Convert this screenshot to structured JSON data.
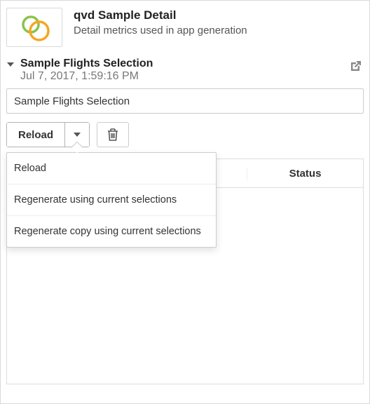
{
  "app": {
    "title": "qvd Sample Detail",
    "subtitle": "Detail metrics used in app generation"
  },
  "section": {
    "title": "Sample Flights Selection",
    "date": "Jul 7, 2017, 1:59:16 PM"
  },
  "name_input": {
    "value": "Sample Flights Selection",
    "placeholder": ""
  },
  "actions": {
    "reload_label": "Reload",
    "menu": [
      "Reload",
      "Regenerate using current selections",
      "Regenerate copy using current selections"
    ]
  },
  "table": {
    "col1_about": "",
    "col2_label": "Status"
  }
}
